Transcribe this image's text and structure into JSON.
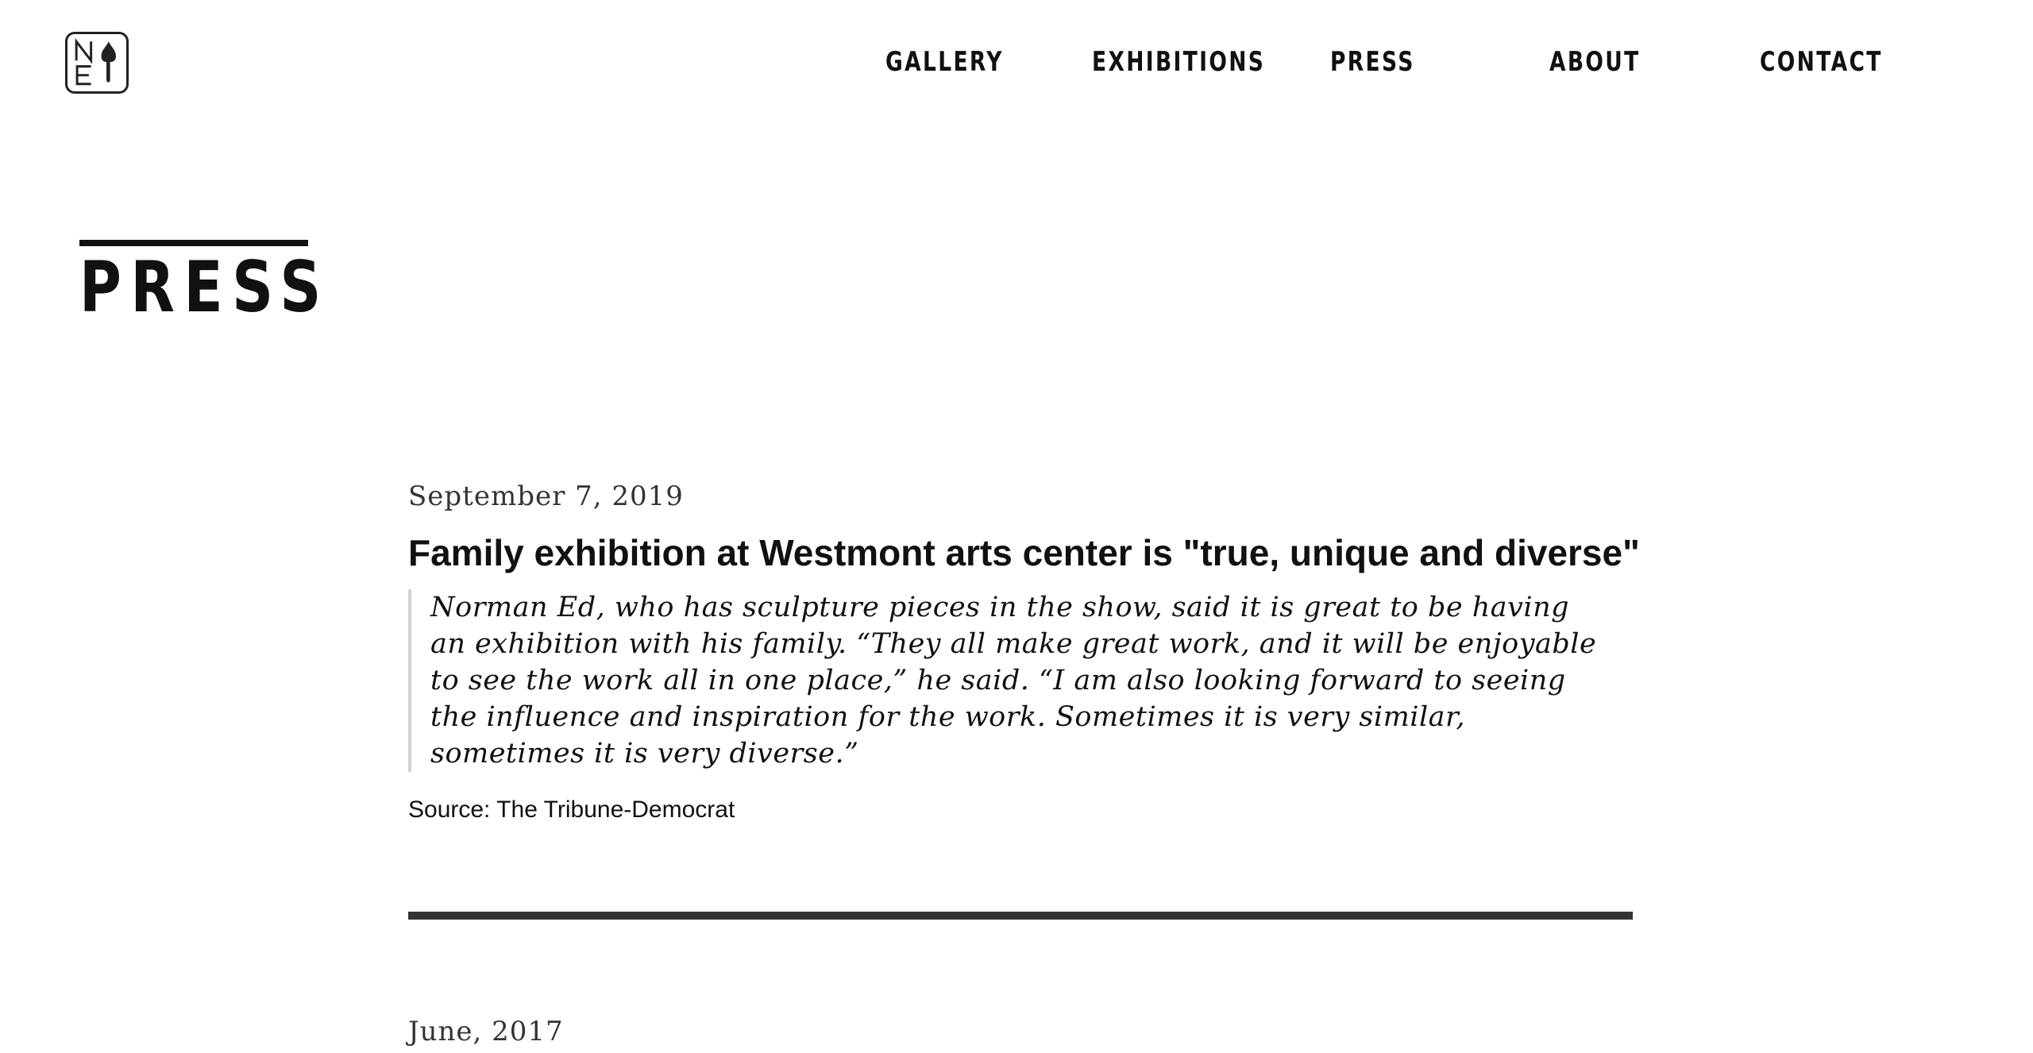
{
  "header": {
    "logo_text": "NE",
    "nav": [
      {
        "label": "GALLERY"
      },
      {
        "label": "EXHIBITIONS"
      },
      {
        "label": "PRESS"
      },
      {
        "label": "ABOUT"
      },
      {
        "label": "CONTACT"
      }
    ]
  },
  "page": {
    "title": "PRESS"
  },
  "articles": [
    {
      "date": "September 7, 2019",
      "headline": "Family exhibition at Westmont arts center is \"true, unique and diverse\"",
      "quote": "Norman Ed, who has sculpture pieces in the show, said it is great to be having an exhibition with his family. “They all make great work, and it will be enjoyable to see the work all in one place,” he said. “I am also looking forward to seeing the influence and inspiration for the work. Sometimes it is very similar, sometimes it is very diverse.”",
      "source": "Source: The Tribune-Democrat"
    },
    {
      "date": "June, 2017"
    }
  ]
}
